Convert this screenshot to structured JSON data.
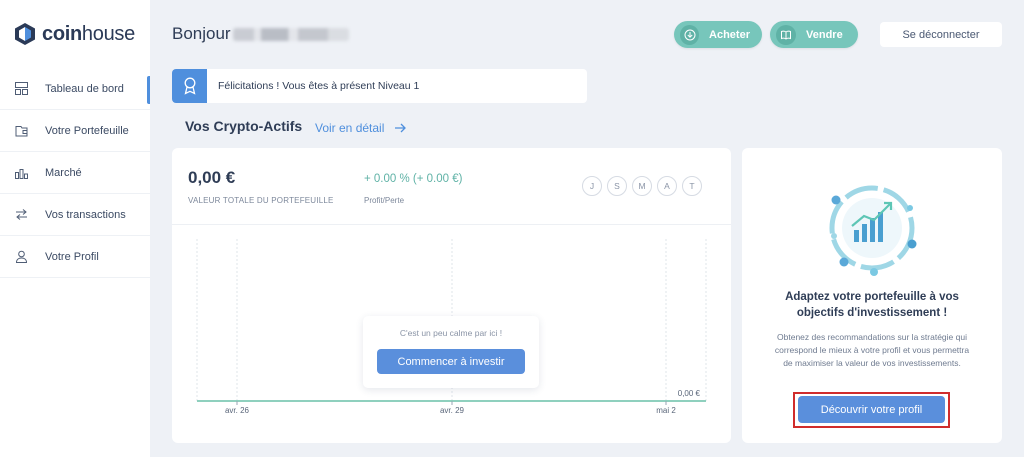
{
  "brand": {
    "logo_text_bold": "coin",
    "logo_text_light": "house",
    "accent": "#4f8fdd",
    "teal": "#77c6bb"
  },
  "sidebar": {
    "items": [
      {
        "label": "Tableau de bord",
        "icon": "dashboard-icon",
        "active": true
      },
      {
        "label": "Votre Portefeuille",
        "icon": "wallet-icon",
        "active": false
      },
      {
        "label": "Marché",
        "icon": "bar-chart-icon",
        "active": false
      },
      {
        "label": "Vos transactions",
        "icon": "transfer-arrows-icon",
        "active": false
      },
      {
        "label": "Votre Profil",
        "icon": "user-icon",
        "active": false
      }
    ]
  },
  "header": {
    "greeting": "Bonjour",
    "buy_label": "Acheter",
    "sell_label": "Vendre",
    "logout_label": "Se déconnecter"
  },
  "notification": {
    "text": "Félicitations ! Vous êtes à présent Niveau 1",
    "icon": "award-ribbon-icon"
  },
  "section": {
    "title": "Vos Crypto-Actifs",
    "link_label": "Voir en détail"
  },
  "portfolio": {
    "total_value": "0,00 €",
    "total_label": "VALEUR TOTALE DU PORTEFEUILLE",
    "profit_value": "+ 0.00 % (+ 0.00 €)",
    "profit_label": "Profit/Perte",
    "periods": [
      "J",
      "S",
      "M",
      "A",
      "T"
    ],
    "chart_end_label": "0,00 €",
    "x_ticks": [
      "avr. 26",
      "avr. 29",
      "mai 2"
    ],
    "cta_text": "C'est un peu calme par ici !",
    "cta_button": "Commencer à investir"
  },
  "promo": {
    "title_line1": "Adaptez votre portefeuille à vos",
    "title_line2": "objectifs d'investissement !",
    "desc_line1": "Obtenez des recommandations sur la stratégie qui",
    "desc_line2": "correspond le mieux à votre profil et vous permettra",
    "desc_line3": "de maximiser la valeur de vos investissements.",
    "button": "Découvrir votre profil",
    "illustration_icon": "growth-chart-coins-icon"
  }
}
